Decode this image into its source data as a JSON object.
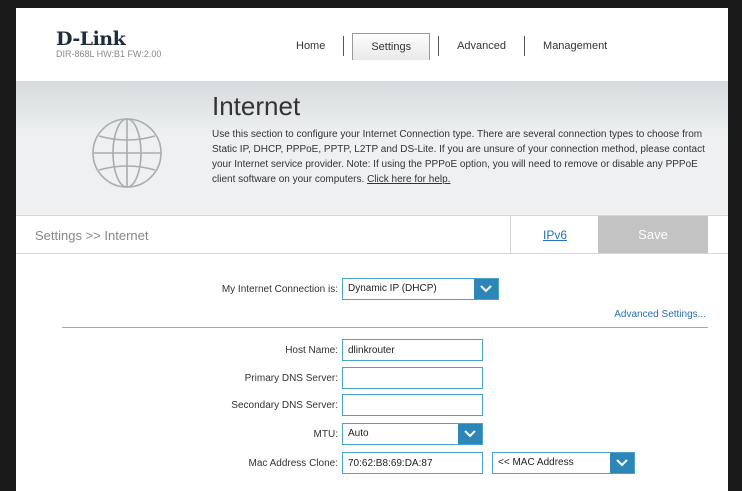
{
  "brand": {
    "logo": "D-Link",
    "model_info": "DIR-868L   HW:B1   FW:2.00"
  },
  "nav": {
    "home": "Home",
    "settings": "Settings",
    "advanced": "Advanced",
    "management": "Management"
  },
  "banner": {
    "title": "Internet",
    "description": "Use this section to configure your Internet Connection type. There are several connection types to choose from Static IP, DHCP, PPPoE, PPTP, L2TP and DS-Lite. If you are unsure of your connection method, please contact your Internet service provider. Note: If using the PPPoE option, you will need to remove or disable any PPPoE client software on your computers.",
    "help_link": "Click here for help."
  },
  "bar": {
    "breadcrumb": "Settings >> Internet",
    "ipv6_link": "IPv6",
    "save_label": "Save"
  },
  "form": {
    "connection_label": "My Internet Connection is:",
    "connection_value": "Dynamic IP (DHCP)",
    "advanced_link": "Advanced Settings...",
    "host_label": "Host Name:",
    "host_value": "dlinkrouter",
    "dns1_label": "Primary DNS Server:",
    "dns1_value": "",
    "dns2_label": "Secondary DNS Server:",
    "dns2_value": "",
    "mtu_label": "MTU:",
    "mtu_value": "Auto",
    "mac_label": "Mac Address Clone:",
    "mac_value": "70:62:B8:69:DA:87",
    "mac_select_value": "<< MAC Address"
  },
  "colors": {
    "accent": "#2d86b7",
    "link": "#2a6ebb",
    "save_bg": "#c3c3c3"
  },
  "icons": {
    "globe": "globe-icon",
    "dropdown": "chevron-down-icon"
  }
}
